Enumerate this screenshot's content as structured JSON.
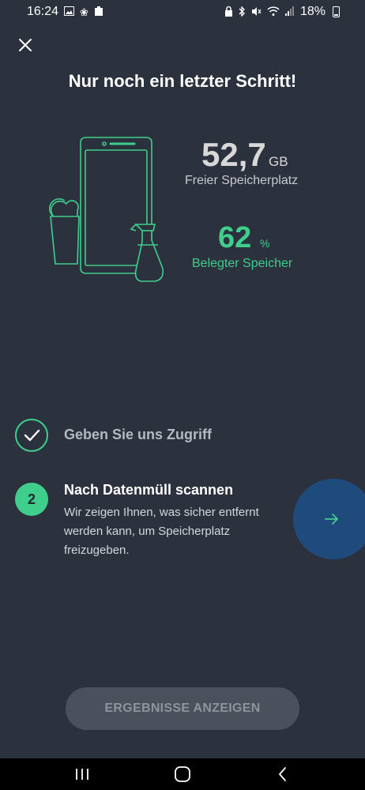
{
  "status_bar": {
    "time": "16:24",
    "battery": "18%",
    "left_icons": [
      "image-icon",
      "fan-icon",
      "clipboard-icon"
    ],
    "right_icons": [
      "lock-icon",
      "bluetooth-icon",
      "mute-icon",
      "wifi-icon",
      "signal-icon",
      "battery-icon"
    ]
  },
  "header": {
    "close_icon": "close-icon",
    "title": "Nur noch ein letzter Schritt!"
  },
  "storage": {
    "free_value": "52,7",
    "free_unit": "GB",
    "free_label": "Freier Speicherplatz",
    "used_value": "62",
    "used_unit": "%",
    "used_label": "Belegter Speicher"
  },
  "steps": [
    {
      "state": "done",
      "label": "Geben Sie uns Zugriff"
    },
    {
      "number": "2",
      "title": "Nach Datenmüll scannen",
      "description": "Wir zeigen Ihnen, was sicher entfernt werden kann, um Speicherplatz freizugeben."
    }
  ],
  "next_button_icon": "arrow-right-icon",
  "results_button": "ERGEBNISSE ANZEIGEN",
  "nav_bar": [
    "recent-apps-icon",
    "home-icon",
    "back-icon"
  ],
  "colors": {
    "background": "#2b313d",
    "accent_green": "#3fce8c",
    "next_button_blue": "#1f4b7c",
    "disabled_button": "#4a505c"
  }
}
